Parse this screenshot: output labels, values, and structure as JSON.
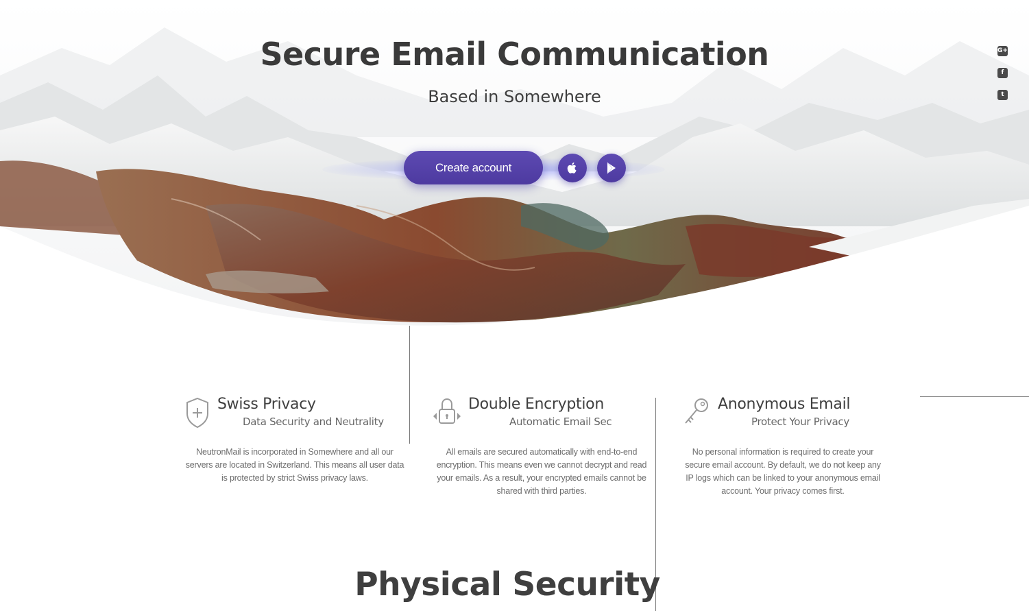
{
  "hero": {
    "title": "Secure Email Communication",
    "subtitle": "Based in Somewhere",
    "create_account_label": "Create account",
    "apple_icon": "apple-icon",
    "play_icon": "google-play-icon",
    "accent_color": "#5546ab"
  },
  "social": {
    "google_plus_glyph": "G+",
    "facebook_glyph": "f",
    "twitter_glyph": "t"
  },
  "features": [
    {
      "icon": "shield-plus-icon",
      "title": "Swiss Privacy",
      "subtitle": "Data Security and Neutrality",
      "body": [
        "NeutronMail is incorporated in Somewhere and all our",
        "servers are located in Switzerland. This means all user data",
        "is protected by strict Swiss privacy laws."
      ]
    },
    {
      "icon": "padlock-icon",
      "title": "Double Encryption",
      "subtitle": "Automatic Email Sec",
      "body": [
        "All emails are secured automatically with end-to-end",
        "encryption. This means even we cannot decrypt and read",
        "your emails. As a result, your encrypted emails cannot be",
        "shared with third parties."
      ]
    },
    {
      "icon": "key-icon",
      "title": "Anonymous Email",
      "subtitle": "Protect Your Privacy",
      "body": [
        "No personal information is required to create your",
        "secure email account. By default, we do not keep any",
        "IP logs which can be linked to your anonymous email",
        "account. Your privacy comes first."
      ]
    }
  ],
  "section": {
    "title": "Physical Security"
  }
}
